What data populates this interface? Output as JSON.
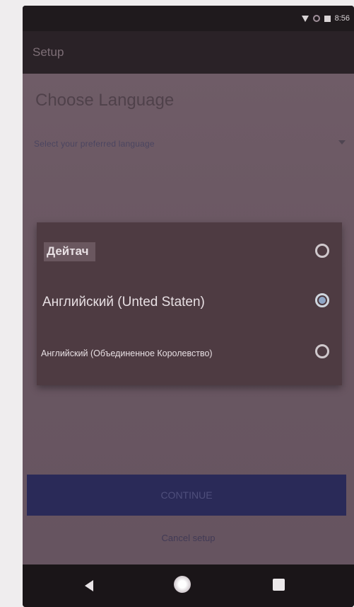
{
  "statusbar": {
    "time": "8:56"
  },
  "appbar": {
    "title": "Setup"
  },
  "screen": {
    "heading": "Choose Language",
    "subtitle": "Select your preferred language"
  },
  "languages": [
    {
      "label": "Дейтач",
      "selected": false
    },
    {
      "label": "Английский (Unted Staten)",
      "selected": true
    },
    {
      "label": "Английский (Объединенное Королевство)",
      "selected": false
    }
  ],
  "actions": {
    "continue_label": "CONTINUE",
    "cancel_label": "Cancel setup"
  },
  "icons": {
    "wifi": "wifi-icon",
    "signal": "signal-icon",
    "battery": "battery-icon",
    "back": "back-icon",
    "home": "home-icon",
    "recents": "recents-icon",
    "dropdown": "chevron-down-icon"
  },
  "colors": {
    "content_bg": "#6c5964",
    "card_bg": "#4e3b42",
    "button_bg": "#2a2a58",
    "radio_selected": "#8fa6c6"
  }
}
